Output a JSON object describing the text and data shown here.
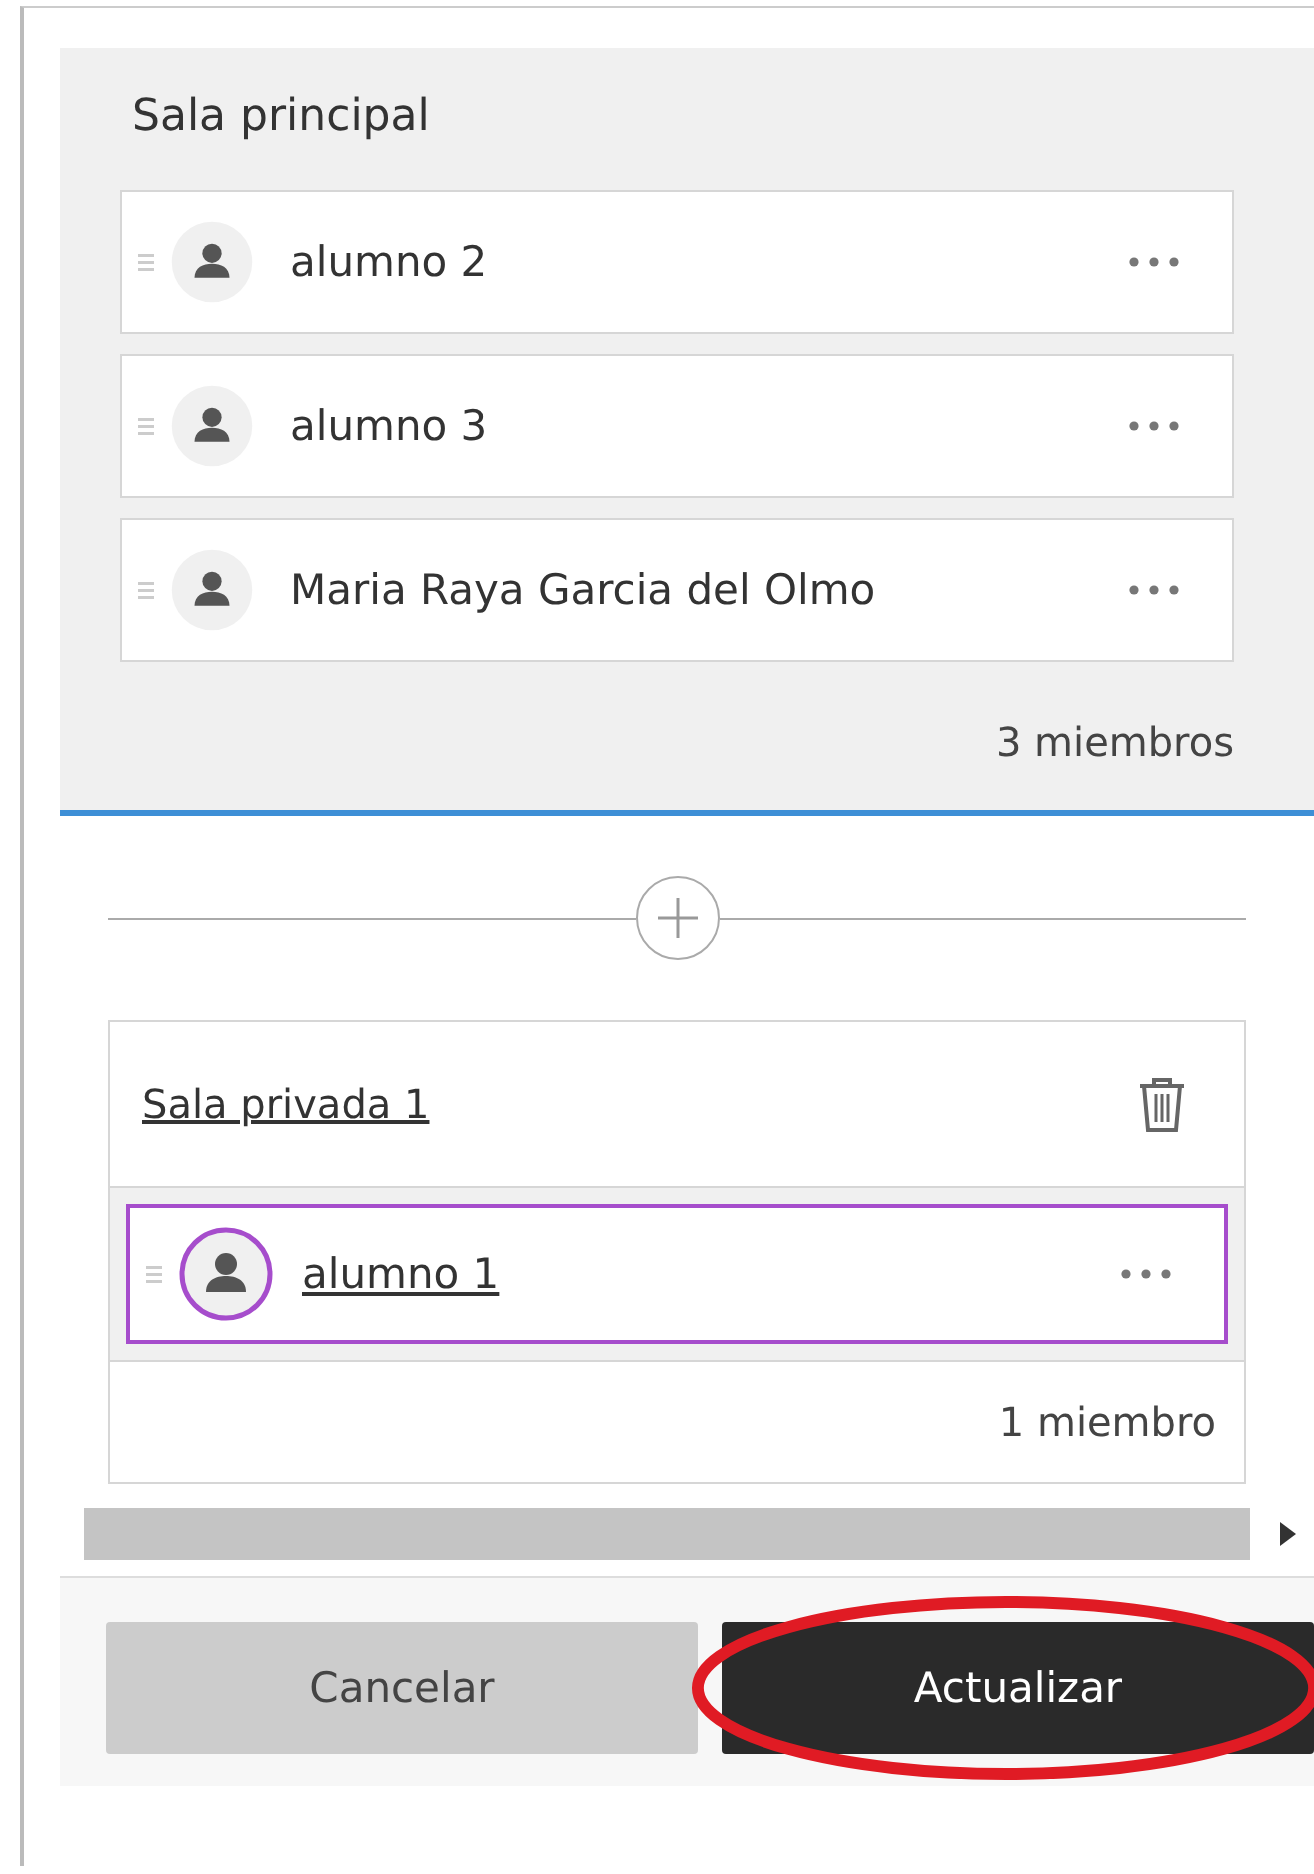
{
  "main_room": {
    "title": "Sala principal",
    "members": [
      {
        "name": "alumno 2",
        "selected": false
      },
      {
        "name": "alumno 3",
        "selected": false
      },
      {
        "name": "Maria Raya Garcia del Olmo",
        "selected": false
      }
    ],
    "count": "3 miembros"
  },
  "private_rooms": [
    {
      "title": "Sala privada 1",
      "members": [
        {
          "name": "alumno 1",
          "selected": true
        }
      ],
      "count": "1 miembro"
    }
  ],
  "buttons": [
    {
      "label": "Cancelar",
      "kind": "secondary",
      "circled": false
    },
    {
      "label": "Actualizar",
      "kind": "primary",
      "circled": true
    }
  ]
}
